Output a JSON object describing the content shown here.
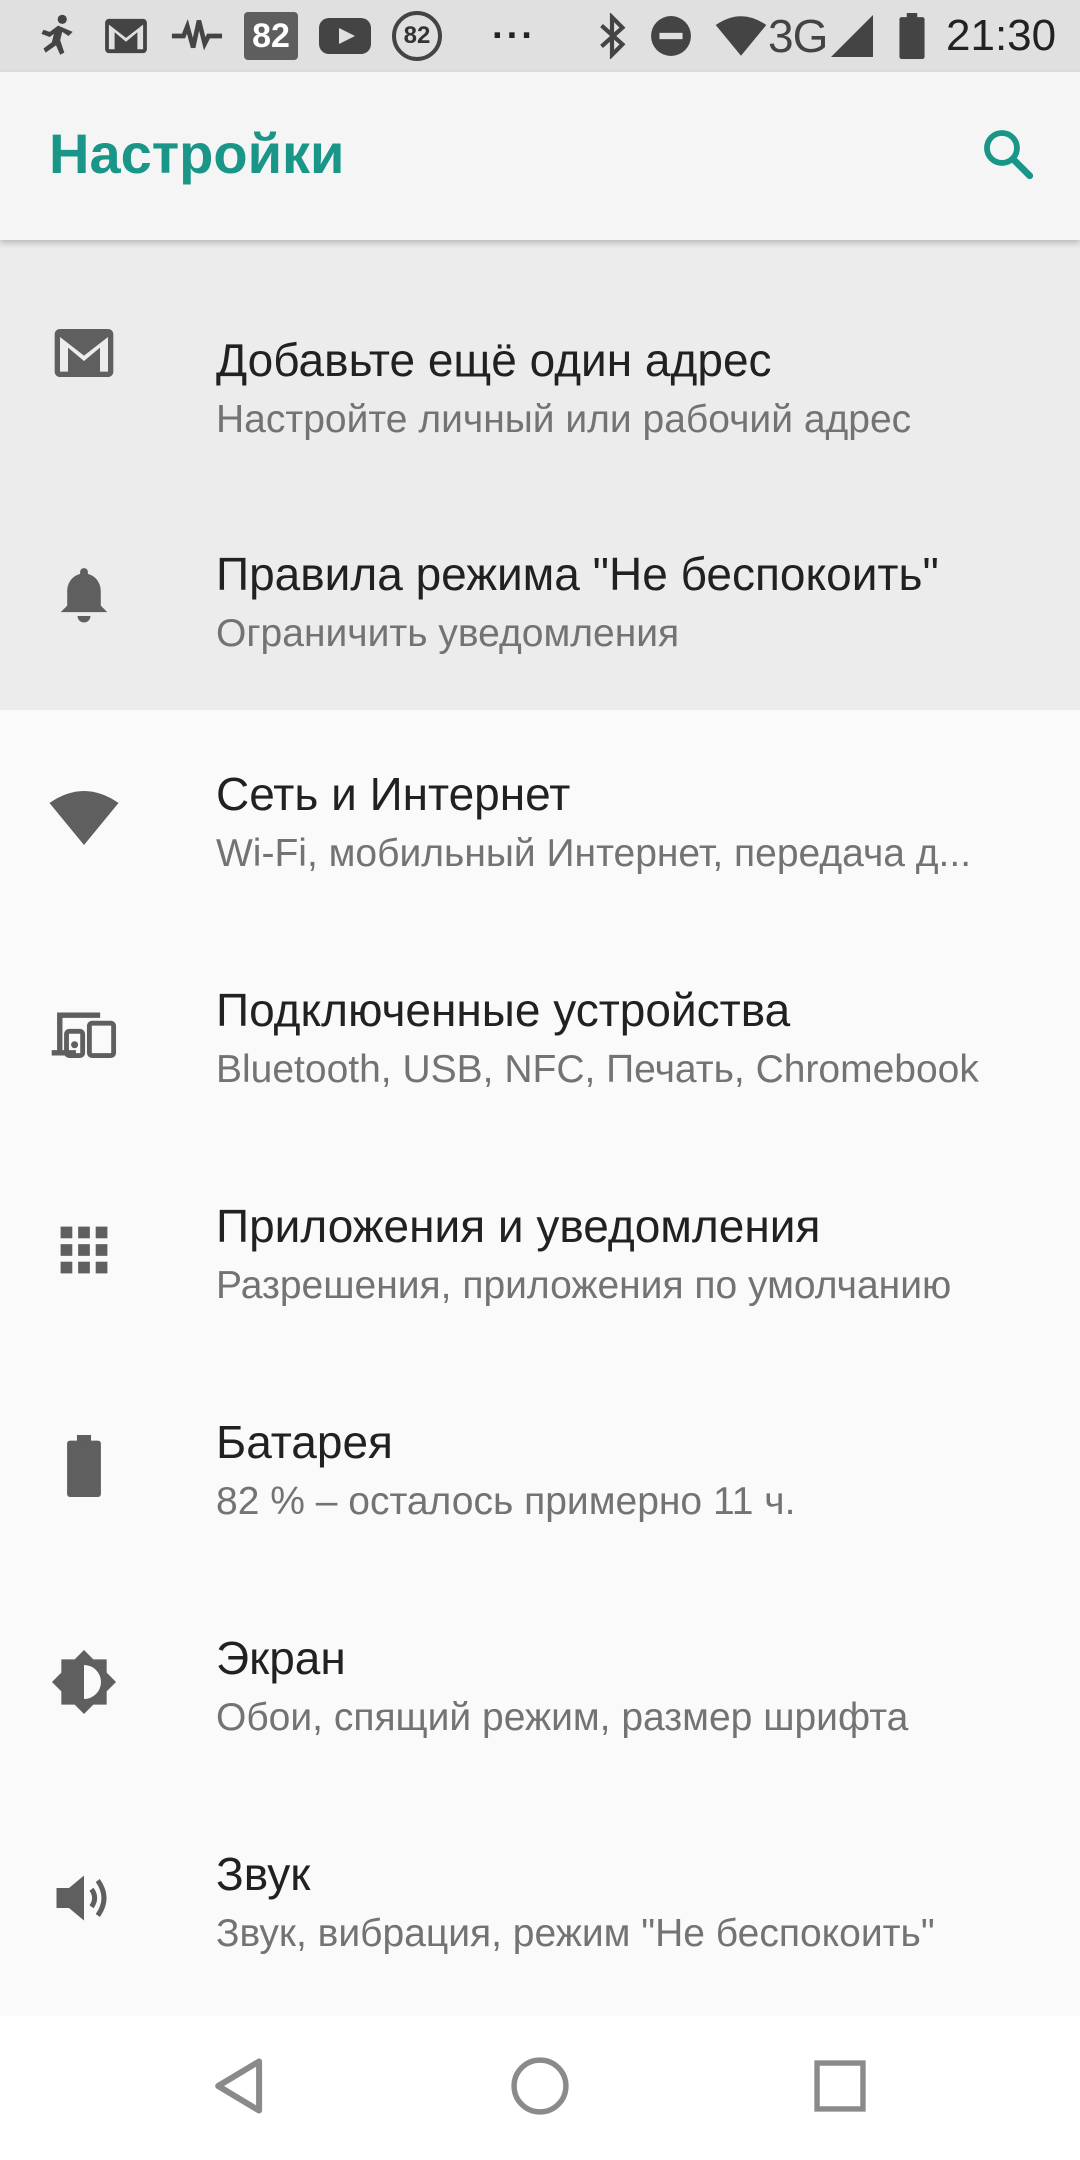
{
  "status_bar": {
    "badge_number": "82",
    "circle_number": "82",
    "more_dots": "···",
    "network_type": "3G",
    "time": "21:30",
    "icons": [
      "runner-icon",
      "gmail-icon",
      "pulse-icon",
      "badge-82-icon",
      "youtube-icon",
      "circle-82-icon",
      "more-icon",
      "bluetooth-icon",
      "do-not-disturb-icon",
      "wifi-icon",
      "cell-signal-icon",
      "battery-icon"
    ]
  },
  "app_bar": {
    "title": "Настройки",
    "search_icon": "search-icon"
  },
  "colors": {
    "accent": "#1a9688",
    "status_bar_bg": "#e0e0e0",
    "suggestion_bg": "#ececec",
    "icon_color": "#5f5f5f"
  },
  "suggestions": [
    {
      "icon": "mail-icon",
      "title": "Добавьте ещё один адрес",
      "subtitle": "Настройте личный или рабочий адрес"
    },
    {
      "icon": "bell-icon",
      "title": "Правила режима \"Не беспокоить\"",
      "subtitle": "Ограничить уведомления"
    }
  ],
  "settings": [
    {
      "icon": "wifi-icon",
      "title": "Сеть и Интернет",
      "subtitle": "Wi-Fi, мобильный Интернет, передача д..."
    },
    {
      "icon": "connected-devices-icon",
      "title": "Подключенные устройства",
      "subtitle": "Bluetooth, USB, NFC, Печать, Chromebook"
    },
    {
      "icon": "apps-grid-icon",
      "title": "Приложения и уведомления",
      "subtitle": "Разрешения, приложения по умолчанию"
    },
    {
      "icon": "battery-icon",
      "title": "Батарея",
      "subtitle": "82 % – осталось примерно 11 ч."
    },
    {
      "icon": "brightness-icon",
      "title": "Экран",
      "subtitle": "Обои, спящий режим, размер шрифта"
    },
    {
      "icon": "volume-icon",
      "title": "Звук",
      "subtitle": "Звук, вибрация, режим \"Не беспокоить\""
    }
  ],
  "nav_bar": {
    "buttons": [
      "back-icon",
      "home-icon",
      "recents-icon"
    ]
  }
}
